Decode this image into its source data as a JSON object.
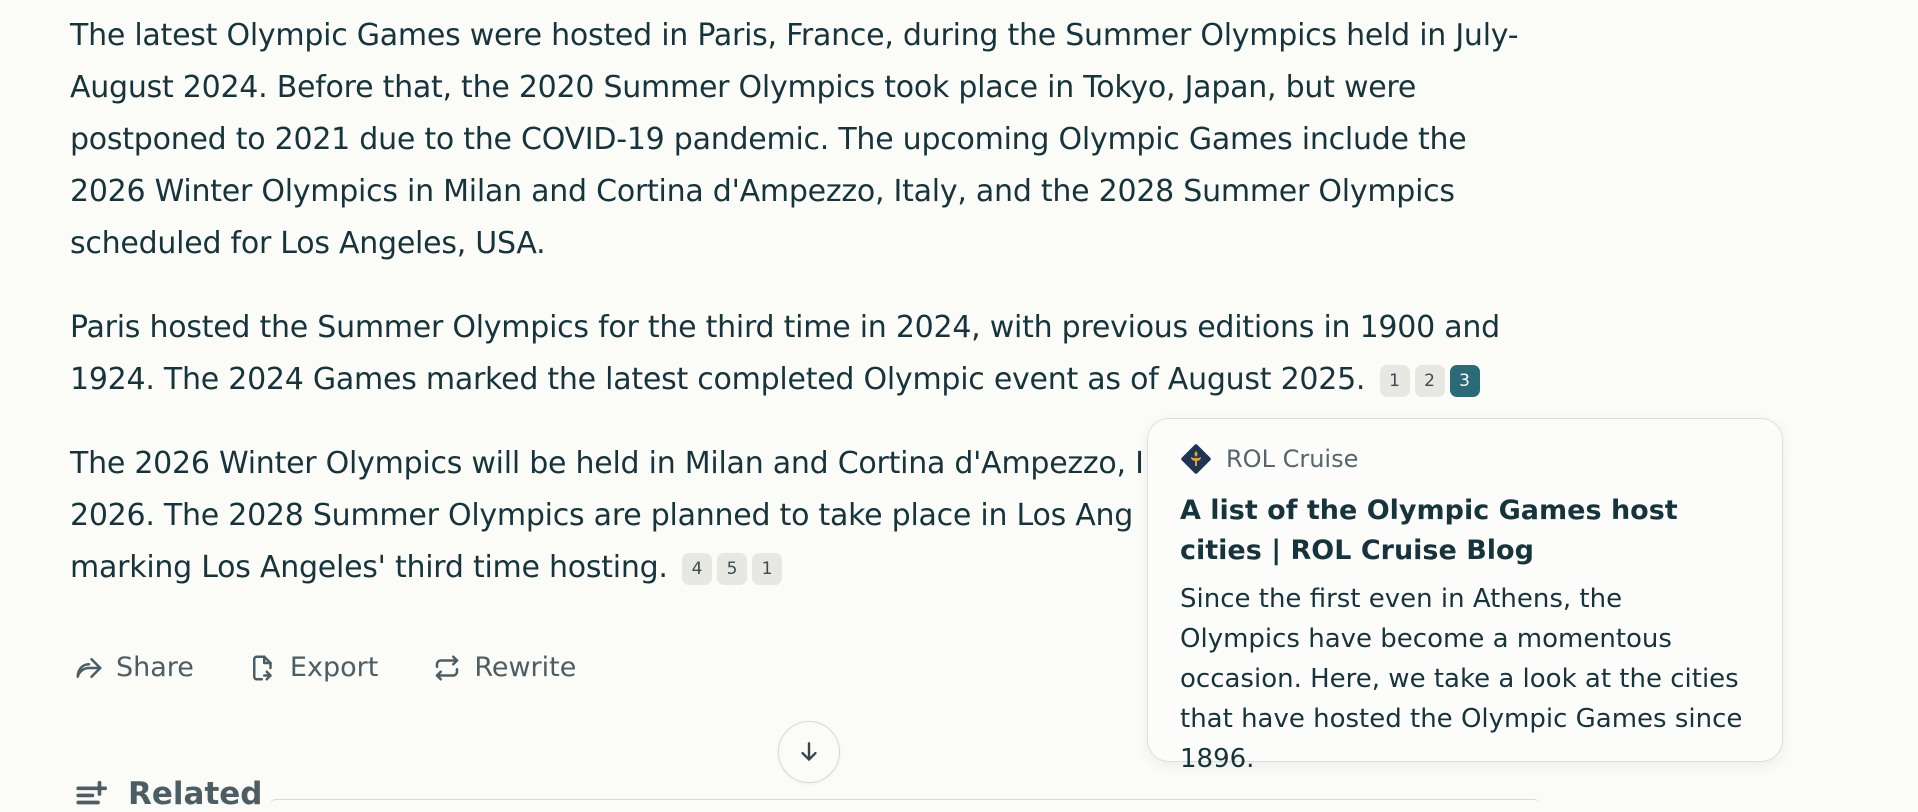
{
  "answer": {
    "paragraphs": [
      {
        "text": "The latest Olympic Games were hosted in Paris, France, during the Summer Olympics held in July-August 2024. Before that, the 2020 Summer Olympics took place in Tokyo, Japan, but were postponed to 2021 due to the COVID-19 pandemic. The upcoming Olympic Games include the 2026 Winter Olympics in Milan and Cortina d'Ampezzo, Italy, and the 2028 Summer Olympics scheduled for Los Angeles, USA.",
        "citations": []
      },
      {
        "text": "Paris hosted the Summer Olympics for the third time in 2024, with previous editions in 1900 and 1924. The 2024 Games marked the latest completed Olympic event as of August 2025.",
        "citations": [
          "1",
          "2",
          "3"
        ]
      },
      {
        "text_visible_start": "The 2026 Winter Olympics will be held in Milan and Cortina d'Ampezzo, I",
        "text_visible_line2": "2026. The 2028 Summer Olympics are planned to take place in Los Ang",
        "text_visible_line3": "marking Los Angeles' third time hosting.",
        "citations": [
          "4",
          "5",
          "1"
        ]
      }
    ]
  },
  "actions": {
    "share_label": "Share",
    "export_label": "Export",
    "rewrite_label": "Rewrite"
  },
  "related": {
    "title": "Related"
  },
  "popover": {
    "source": "ROL Cruise",
    "title": "A list of the Olympic Games host cities | ROL Cruise Blog",
    "description": "Since the first even in Athens, the Olympics have become a momentous occasion. Here, we take a look at the cities that have hosted the Olympic Games since 1896.",
    "logo_color": "#1e3556",
    "logo_accent": "#d9a441"
  },
  "colors": {
    "active_citation": "#2d6a78",
    "text": "#17343c",
    "muted": "#4c5d63"
  }
}
